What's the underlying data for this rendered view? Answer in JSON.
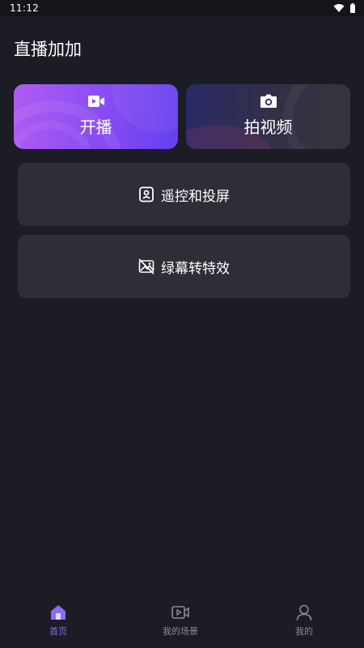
{
  "status_bar": {
    "time": "11:12"
  },
  "app": {
    "title": "直播加加"
  },
  "cards": {
    "live": {
      "label": "开播",
      "icon": "video-camera-icon"
    },
    "video": {
      "label": "拍视频",
      "icon": "camera-icon"
    }
  },
  "rows": {
    "remote": {
      "label": "遥控和投屏",
      "icon": "remote-control-icon"
    },
    "green_screen": {
      "label": "绿幕转特效",
      "icon": "green-screen-image-icon"
    }
  },
  "tabbar": {
    "home": {
      "label": "首页",
      "icon": "home-icon",
      "active": true
    },
    "scenes": {
      "label": "我的场景",
      "icon": "video-scene-icon"
    },
    "mine": {
      "label": "我的",
      "icon": "user-icon"
    }
  },
  "colors": {
    "background": "#1c1c24",
    "row_card": "#2e2e36",
    "live_gradient_start": "#b05cf2",
    "live_gradient_end": "#6340ef",
    "active_tab": "#8a6cf3",
    "inactive_tab": "#8a8a92"
  }
}
